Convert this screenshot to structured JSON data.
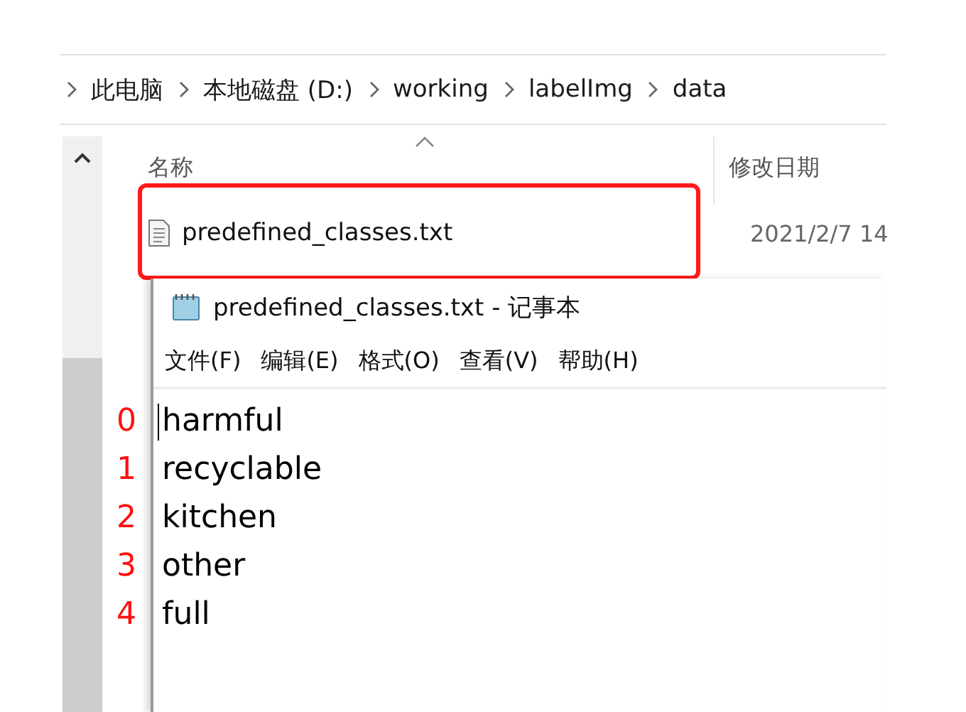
{
  "breadcrumb": [
    "此电脑",
    "本地磁盘 (D:)",
    "working",
    "labelImg",
    "data"
  ],
  "file_list": {
    "columns": [
      "名称",
      "修改日期"
    ],
    "rows": [
      {
        "name": "predefined_classes.txt",
        "modified": "2021/2/7 14"
      }
    ]
  },
  "notepad": {
    "title": "predefined_classes.txt - 记事本",
    "menu": [
      "文件(F)",
      "编辑(E)",
      "格式(O)",
      "查看(V)",
      "帮助(H)"
    ],
    "lines": [
      "harmful",
      "recyclable",
      "kitchen",
      "other",
      "full"
    ]
  },
  "annotations": {
    "line_numbers": [
      "0",
      "1",
      "2",
      "3",
      "4"
    ]
  }
}
